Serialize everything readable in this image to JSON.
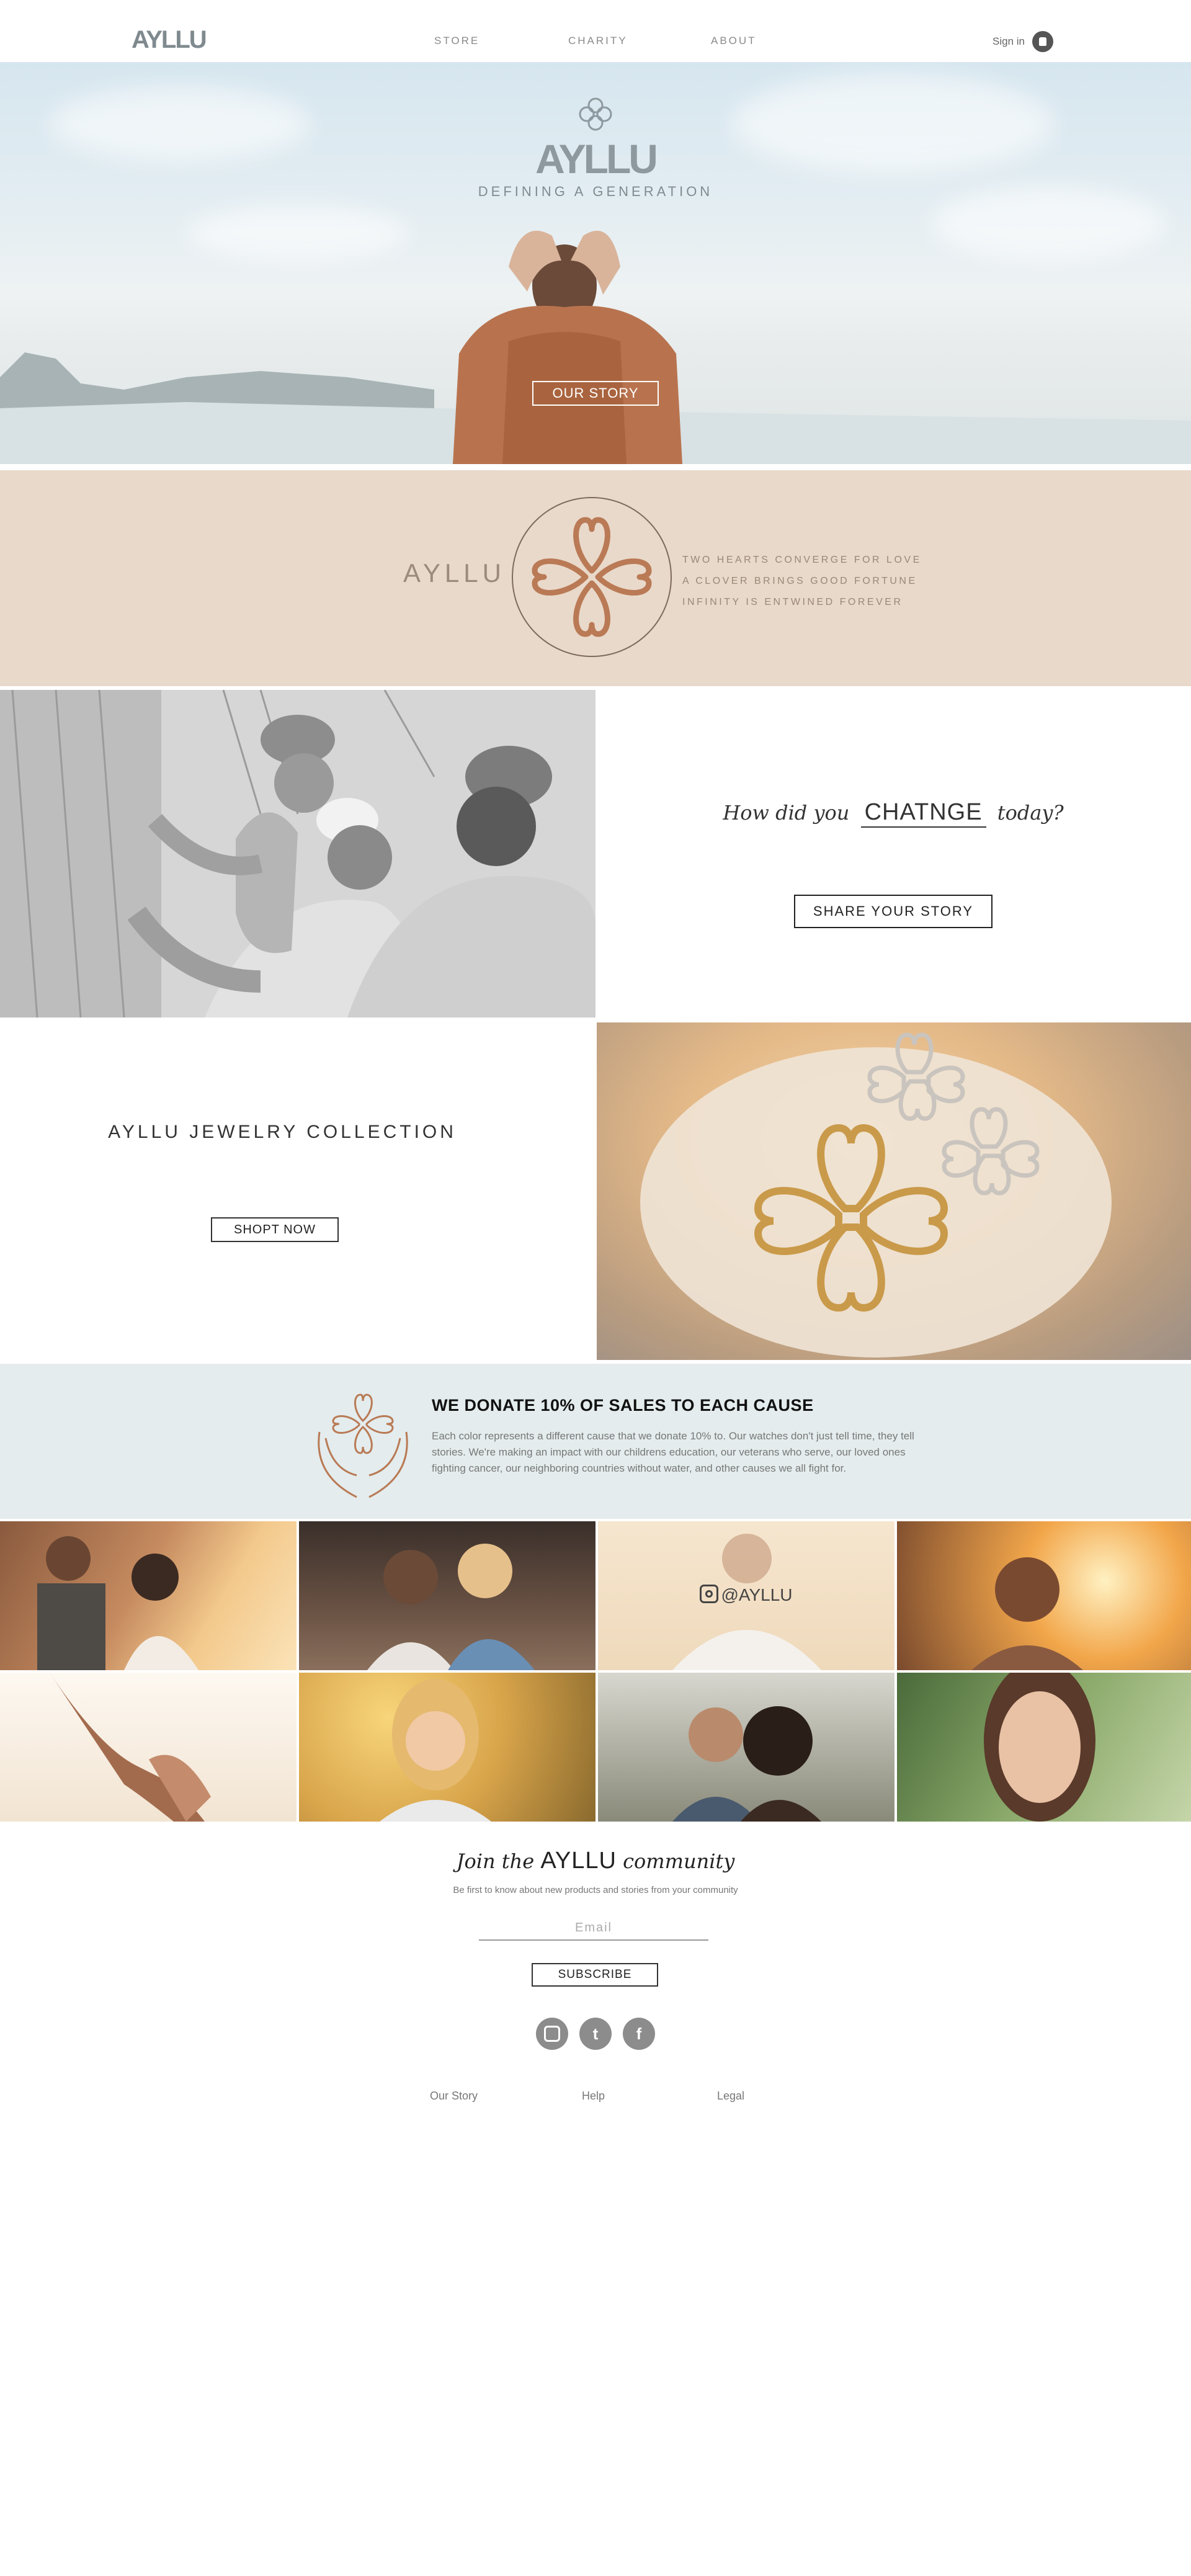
{
  "nav": {
    "logo": "AYLLU",
    "links": [
      "STORE",
      "CHARITY",
      "ABOUT"
    ],
    "signin_label": "Sign in"
  },
  "hero": {
    "logo": "AYLLU",
    "tagline": "DEFINING A GENERATION",
    "button_label": "OUR STORY"
  },
  "brand_band": {
    "word": "AYLLU",
    "lines": [
      "TWO HEARTS CONVERGE FOR LOVE",
      "A CLOVER BRINGS GOOD FORTUNE",
      "INFINITY IS ENTWINED FOREVER"
    ]
  },
  "story": {
    "question_before": "How did you",
    "question_word": "CHATNGE",
    "question_after": "today?",
    "button_label": "SHARE YOUR STORY"
  },
  "jewelry": {
    "title": "AYLLU JEWELRY COLLECTION",
    "button_label": "SHOPT NOW"
  },
  "donate": {
    "title": "WE DONATE 10% OF SALES TO EACH CAUSE",
    "text": "Each color represents a different cause that we donate 10% to. Our watches don't just tell time, they tell stories. We're making an impact with our childrens education, our veterans who serve, our loved ones fighting cancer, our neighboring countries without water, and other causes we all fight for."
  },
  "instagram": {
    "tag": "@AYLLU"
  },
  "community": {
    "join_before": "Join the",
    "join_brand": "AYLLU",
    "join_after": "community",
    "subtitle": "Be first to know about new products and stories from your community",
    "email_placeholder": "Email",
    "subscribe_label": "SUBSCRIBE"
  },
  "social": [
    {
      "icon": "instagram-icon",
      "glyph": "◘"
    },
    {
      "icon": "twitter-icon",
      "glyph": "t"
    },
    {
      "icon": "facebook-icon",
      "glyph": "f"
    }
  ],
  "footer": {
    "links": [
      "Our Story",
      "Help",
      "Legal"
    ]
  },
  "colors": {
    "band": "#e9d9ca",
    "donate_bg": "#e4eced",
    "copper": "#b97a55",
    "logo_gray": "#8d999e"
  }
}
